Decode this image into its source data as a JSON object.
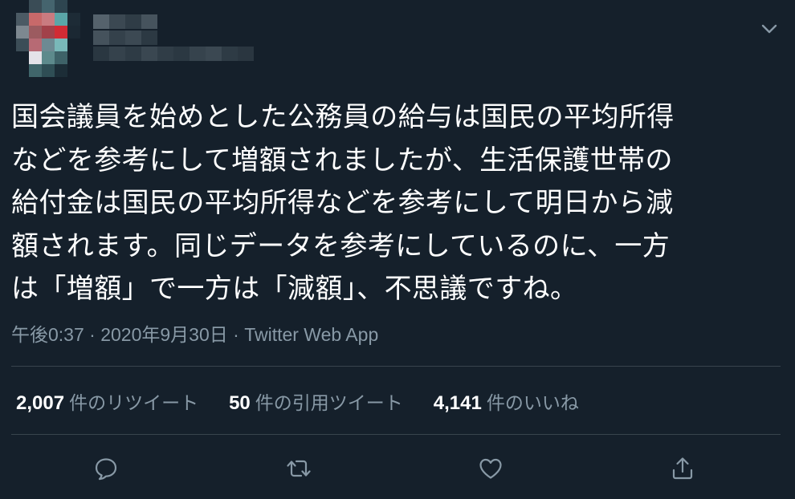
{
  "tweet": {
    "text_lines": [
      "国会議員を始めとした公務員の給与は国民の平均所得",
      "などを参考にして増額されましたが、生活保護世帯の",
      "給付金は国民の平均所得などを参考にして明日から減",
      "額されます。同じデータを参考にしているのに、一方",
      "は「増額」で一方は「減額」、不思議ですね。"
    ],
    "timestamp": "午後0:37 · 2020年9月30日 · ",
    "source": "Twitter Web App"
  },
  "stats": {
    "retweets": {
      "count": "2,007",
      "label": "件のリツイート"
    },
    "quotes": {
      "count": "50",
      "label": "件の引用ツイート"
    },
    "likes": {
      "count": "4,141",
      "label": "件のいいね"
    }
  },
  "icons": {
    "caret": "chevron-down-icon",
    "reply": "reply-icon",
    "retweet": "retweet-icon",
    "like": "heart-icon",
    "share": "share-icon"
  },
  "colors": {
    "background": "#15202b",
    "text": "#ffffff",
    "secondary": "#8899a6",
    "divider": "#38444d"
  }
}
